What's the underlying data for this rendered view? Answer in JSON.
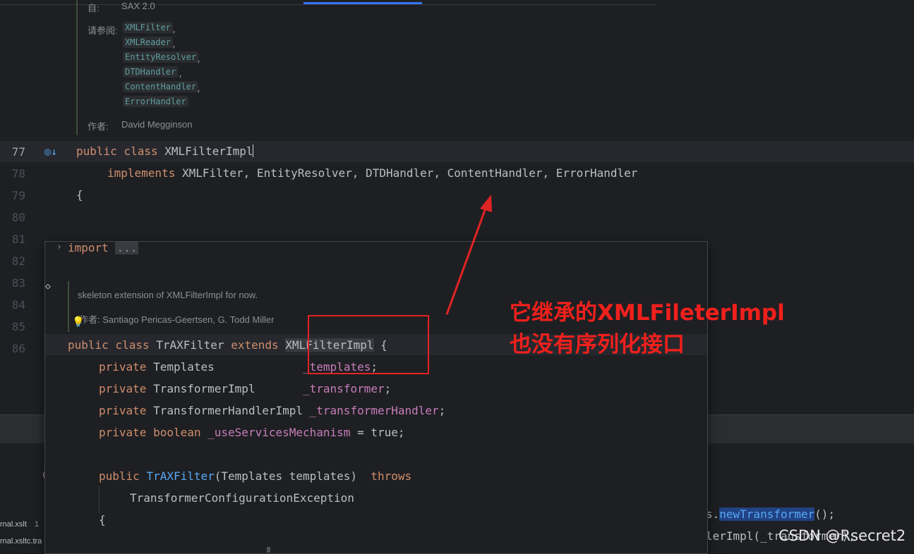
{
  "doc": {
    "since_label": "自:",
    "since_value": "SAX 2.0",
    "see_label": "请参阅:",
    "see_refs": [
      "XMLFilter",
      "XMLReader",
      "EntityResolver",
      "DTDHandler",
      "ContentHandler",
      "ErrorHandler"
    ],
    "author_label": "作者:",
    "author_value": "David Megginson"
  },
  "line_numbers": [
    "77",
    "78",
    "79",
    "80",
    "81",
    "82",
    "83",
    "84",
    "85",
    "86"
  ],
  "code": {
    "l77_kw": "public class",
    "l77_cls": "XMLFilterImpl",
    "l78_kw": "implements",
    "l78_rest": "XMLFilter, EntityResolver, DTDHandler, ContentHandler, ErrorHandler",
    "l79": "{"
  },
  "popup": {
    "import_kw": "import",
    "import_fold": "...",
    "doc_text": "skeleton extension of XMLFilterImpl for now.",
    "author_text": "作者: Santiago Pericas-Geertsen, G. Todd Miller",
    "decl_kw": "public class",
    "decl_cls": "TrAXFilter",
    "decl_ext": "extends",
    "decl_super": "XMLFilterImpl",
    "decl_brace": "{",
    "fields": [
      {
        "kw": "private",
        "type": "Templates",
        "name": "_templates",
        "tail": ";"
      },
      {
        "kw": "private",
        "type": "TransformerImpl",
        "name": "_transformer",
        "tail": ";"
      },
      {
        "kw": "private",
        "type": "TransformerHandlerImpl",
        "name": "_transformerHandler",
        "tail": ";"
      },
      {
        "kw": "private boolean",
        "type": "",
        "name": "_useServicesMechanism",
        "tail": " = true;"
      }
    ],
    "ctor_kw": "public",
    "ctor_name": "TrAXFilter",
    "ctor_params": "(Templates templates)",
    "ctor_throws": "throws",
    "ctor_exc": "TransformerConfigurationException",
    "open_brace": "{"
  },
  "background": {
    "right_line1_pre": "s.",
    "right_line1_hl": "newTransformer",
    "right_line1_post": "();",
    "right_line2": "lerImpl(_transformer);",
    "file1": "rnal.xslt",
    "file1_count": "1",
    "file2": "rnal.xsltc.tra"
  },
  "annotation": {
    "line1": "它继承的XMLFileterImpl",
    "line2": "也没有序列化接口"
  },
  "watermark": "CSDN @Rsecret2"
}
